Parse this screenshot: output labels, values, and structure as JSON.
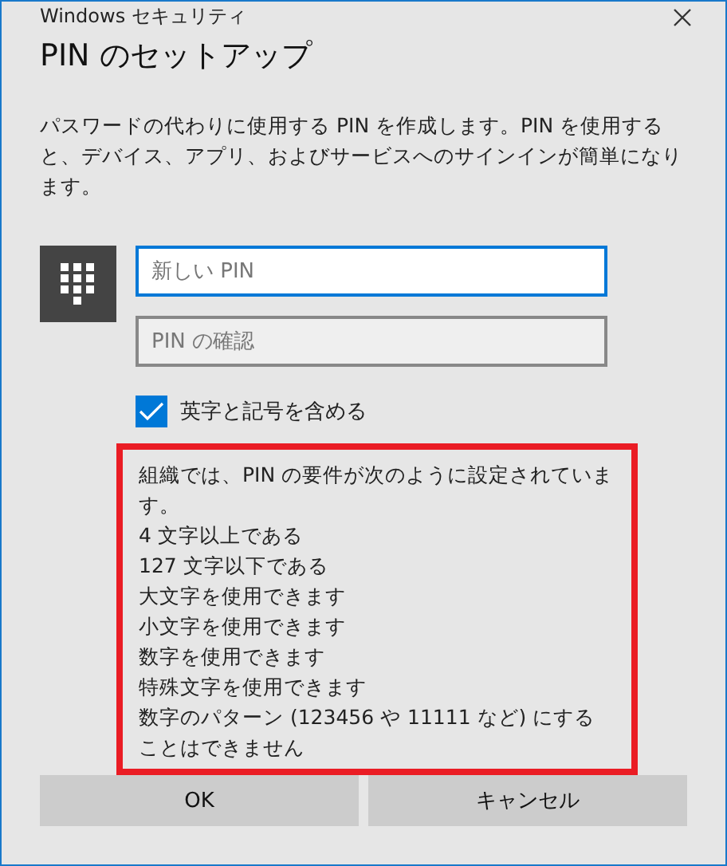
{
  "window": {
    "title": "Windows セキュリティ"
  },
  "heading": "PIN のセットアップ",
  "description": "パスワードの代わりに使用する PIN を作成します。PIN を使用すると、デバイス、アプリ、およびサービスへのサインインが簡単になります。",
  "fields": [
    {
      "placeholder": "新しい PIN",
      "focused": true
    },
    {
      "placeholder": "PIN の確認",
      "focused": false
    }
  ],
  "checkbox": {
    "label": "英字と記号を含める",
    "checked": true
  },
  "requirements": [
    "組織では、PIN の要件が次のように設定されています。",
    "4 文字以上である",
    "127 文字以下である",
    "大文字を使用できます",
    "小文字を使用できます",
    "数字を使用できます",
    "特殊文字を使用できます",
    "数字のパターン (123456 や 11111 など) にすることはできません"
  ],
  "buttons": [
    "OK",
    "キャンセル"
  ]
}
